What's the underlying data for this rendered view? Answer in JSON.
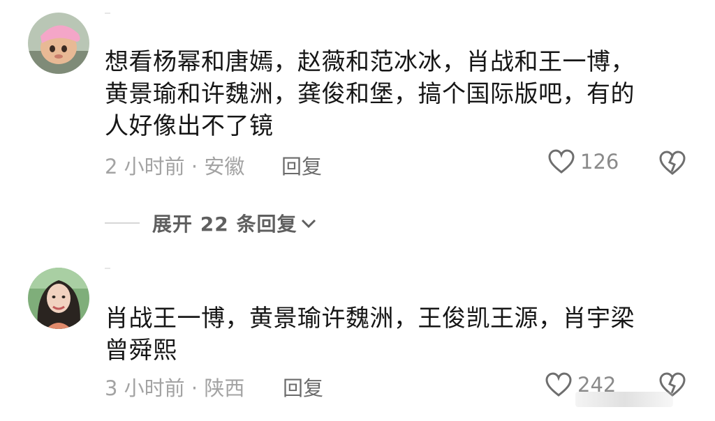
{
  "comments": [
    {
      "text": "想看杨幂和唐嫣，赵薇和范冰冰，肖战和王一博，\n黄景瑜和许魏洲，龚俊和堡，搞个国际版吧，有的\n人好像出不了镜",
      "meta": "2 小时前 · 安徽",
      "reply_label": "回复",
      "likes": "126"
    },
    {
      "text": "肖战王一博，黄景瑜许魏洲，王俊凯王源，肖宇梁\n曾舜熙",
      "meta": "3 小时前 · 陕西",
      "reply_label": "回复",
      "likes": "242"
    }
  ],
  "expand_replies": {
    "label": "展开 22 条回复",
    "icon": "chevron-down-icon"
  },
  "icons": {
    "like": "heart-icon",
    "dislike": "broken-heart-icon"
  },
  "colors": {
    "text": "#161616",
    "meta": "#a3a3a3",
    "icon": "#6e6e6e"
  }
}
